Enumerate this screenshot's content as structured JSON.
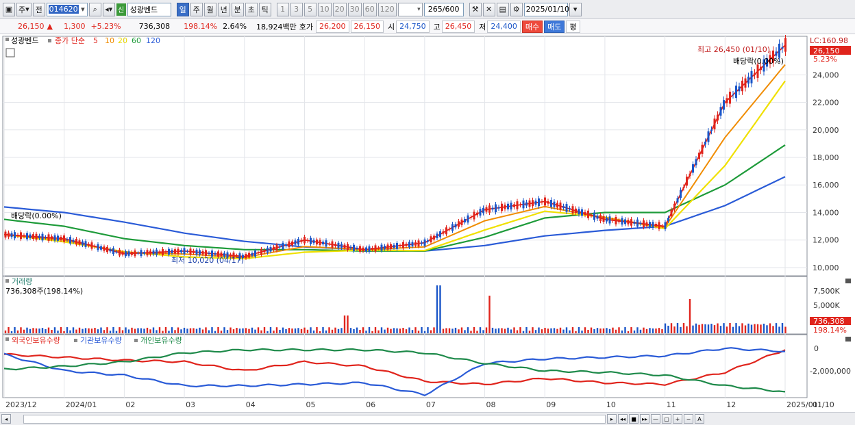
{
  "toolbar": {
    "market_label": "주",
    "all_label": "전",
    "code": "014620",
    "new_badge": "신",
    "stock_name": "성광벤드",
    "periods": [
      "일",
      "주",
      "월",
      "년",
      "분",
      "초",
      "틱"
    ],
    "active_period": "일",
    "intervals": [
      "1",
      "3",
      "5",
      "10",
      "20",
      "30",
      "60",
      "120"
    ],
    "count_value": "265",
    "count_total": "/600",
    "date": "2025/01/10"
  },
  "quote": {
    "price": "26,150",
    "change_arrow": "▲",
    "change": "1,300",
    "change_pct": "+5.23%",
    "volume": "736,308",
    "volume_ratio": "198.14%",
    "turnover_pct": "2.64%",
    "amount": "18,924백만",
    "ask_label": "호가",
    "ask": "26,200",
    "bid": "26,150",
    "open_label": "시",
    "open": "24,750",
    "high_label": "고",
    "high": "26,450",
    "low_label": "저",
    "low": "24,400",
    "buy_label": "매수",
    "sell_label": "매도",
    "eval_label": "평"
  },
  "price_panel": {
    "title": "성광벤드",
    "legend_prefix": "종가 단순",
    "ma_labels": [
      "5",
      "10",
      "20",
      "60",
      "120"
    ],
    "ma_colors": [
      "#e0241c",
      "#f08c00",
      "#f0e000",
      "#1e9b3a",
      "#2a5bd7"
    ],
    "lc_label": "LC:160.98",
    "last_price_tag": "26,150",
    "last_change_tag": "5.23%",
    "high_note": "최고 26,450 (01/10)",
    "low_note": "최저 10,020 (04/17)",
    "dividend_note_left": "배당락(0.00%)",
    "dividend_note_right": "배당락(0.00%)",
    "y_ticks": [
      "24,000",
      "22,000",
      "20,000",
      "18,000",
      "16,000",
      "14,000",
      "12,000",
      "10,000"
    ]
  },
  "volume_panel": {
    "title": "거래량",
    "subtitle": "736,308주(198.14%)",
    "y_ticks": [
      "7,500K",
      "5,000K"
    ],
    "last_tag": "736,308",
    "last_pct_tag": "198.14%"
  },
  "holding_panel": {
    "labels": [
      "외국인보유수량",
      "기관보유수량",
      "개인보유수량"
    ],
    "colors": [
      "#e0241c",
      "#2a5bd7",
      "#1e8a4a"
    ],
    "y_ticks": [
      "0",
      "-2,000,000"
    ]
  },
  "x_axis": {
    "labels": [
      "2023/12",
      "2024/01",
      "02",
      "03",
      "04",
      "05",
      "06",
      "07",
      "08",
      "09",
      "10",
      "11",
      "12",
      "2025/01"
    ],
    "right_label": "01/10"
  },
  "chart_data": {
    "type": "line",
    "months": [
      "2023/12",
      "2024/01",
      "02",
      "03",
      "04",
      "05",
      "06",
      "07",
      "08",
      "09",
      "10",
      "11",
      "12",
      "2025/01"
    ],
    "price_close_approx": [
      12400,
      12100,
      11000,
      11200,
      10800,
      12000,
      11300,
      11800,
      14200,
      14800,
      13500,
      13000,
      22000,
      26150
    ],
    "ma60_approx": [
      13500,
      13000,
      12100,
      11600,
      11300,
      11300,
      11200,
      11200,
      12200,
      13600,
      14000,
      14000,
      16000,
      18900
    ],
    "ma120_approx": [
      14400,
      14000,
      13300,
      12500,
      11900,
      11500,
      11300,
      11200,
      11600,
      12300,
      12700,
      13000,
      14500,
      16600
    ],
    "high": 26450,
    "low": 10020,
    "ylim": [
      9500,
      26800
    ]
  }
}
